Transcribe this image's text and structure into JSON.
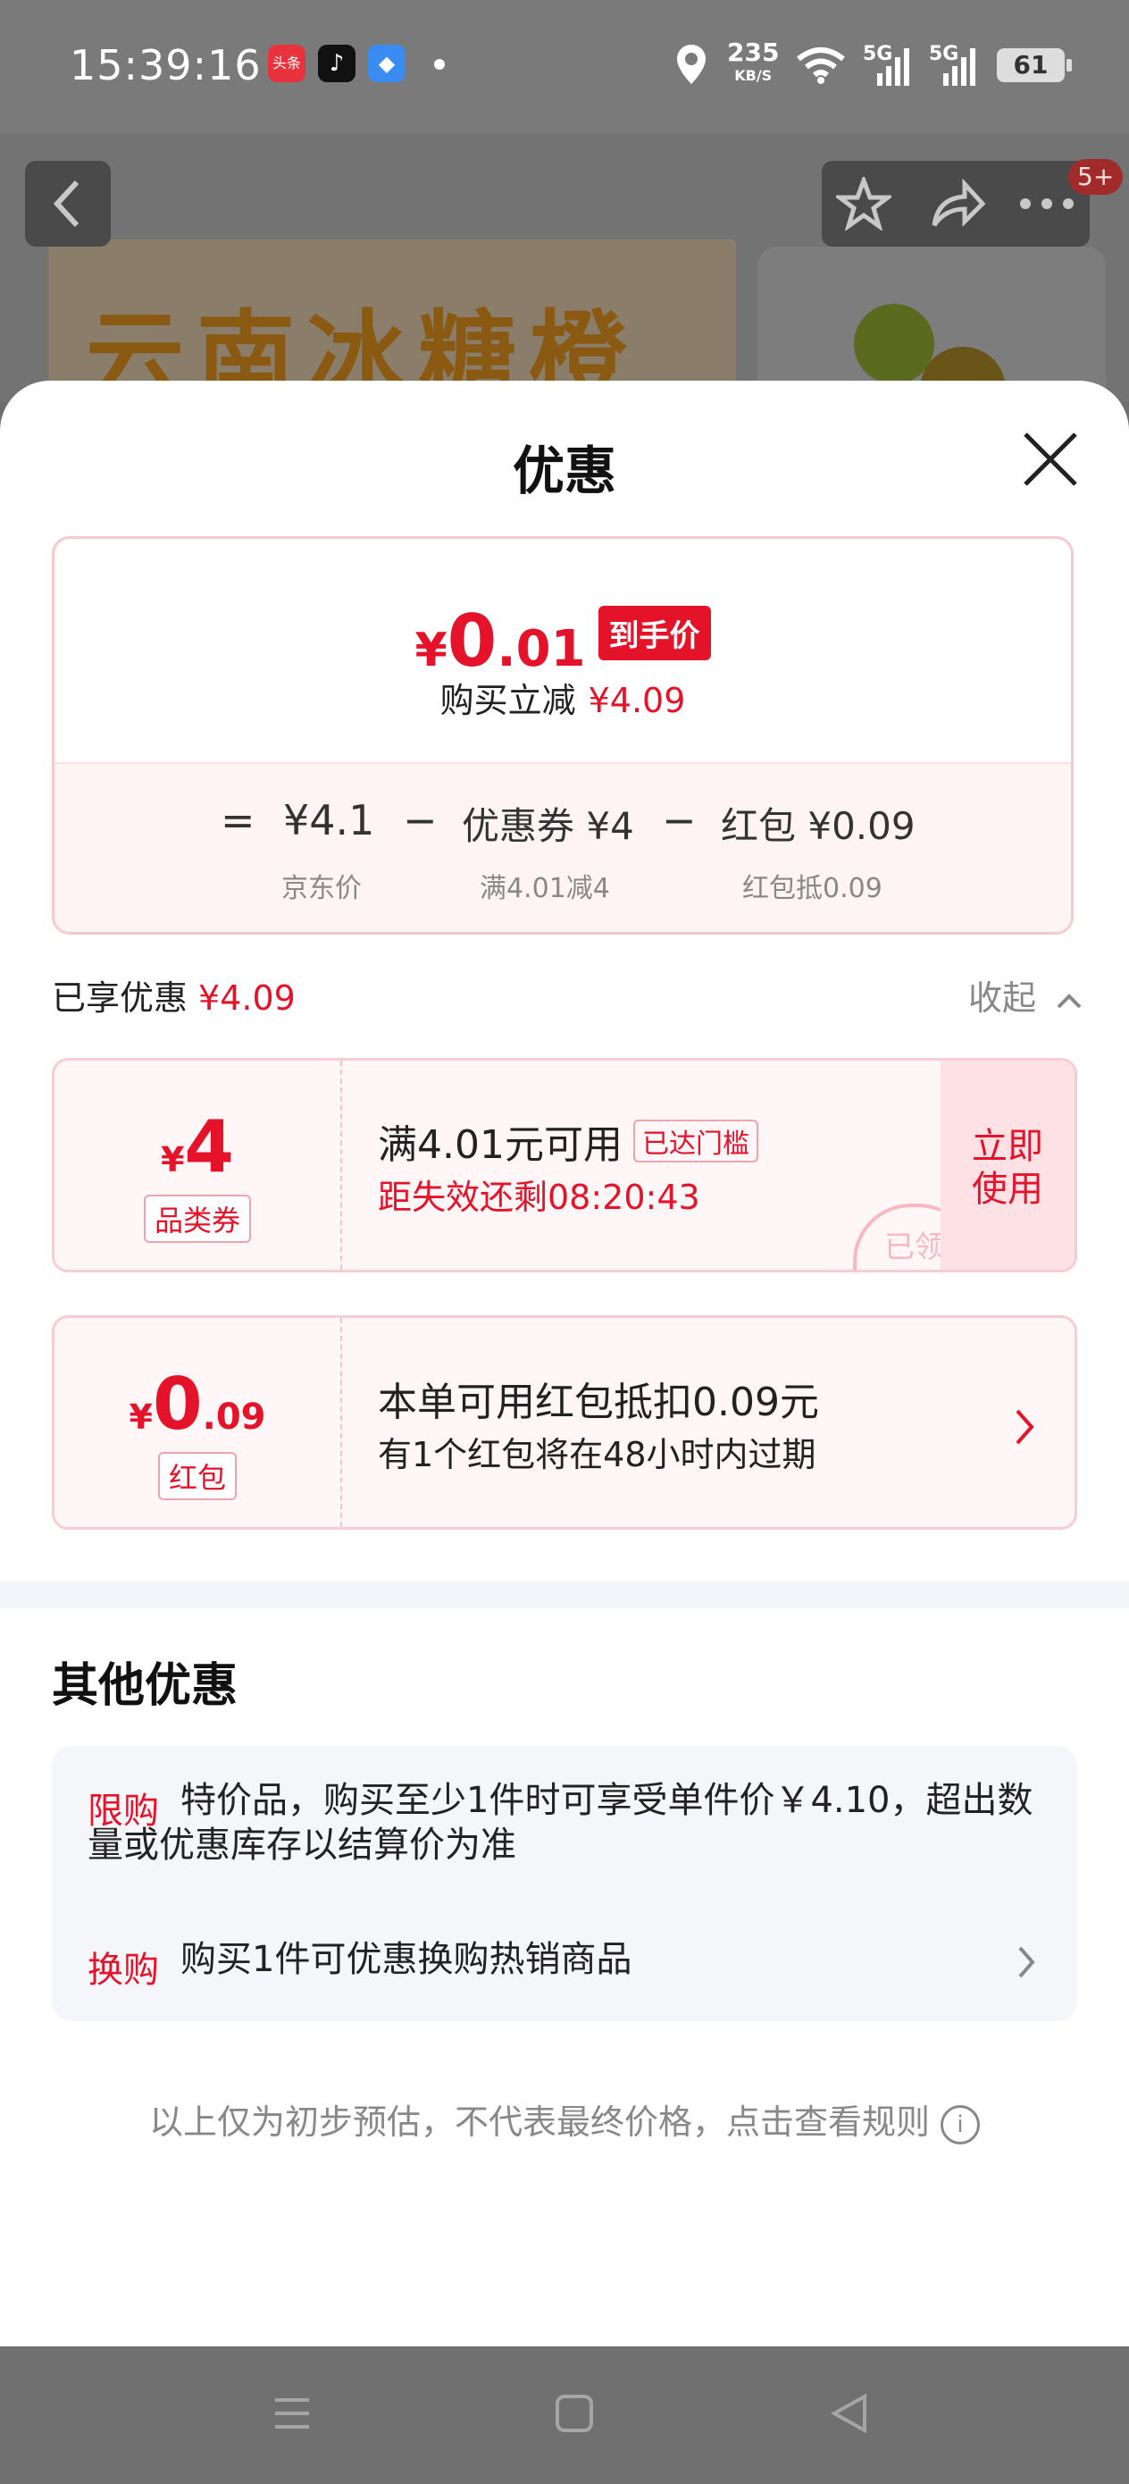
{
  "status_bar": {
    "time": "15:39:16",
    "app_icons": [
      {
        "name": "toutiao-app-icon",
        "label": "头条",
        "color": "#e8333c"
      },
      {
        "name": "tiktok-app-icon",
        "label": "♪",
        "color": "#111111"
      },
      {
        "name": "browser-app-icon",
        "label": "◆",
        "color": "#3a8cf0"
      }
    ],
    "net_speed": "235",
    "net_unit": "KB/S",
    "signal1": "5G",
    "signal2": "5G",
    "battery": "61"
  },
  "header": {
    "banner_text": "云南冰糖橙",
    "badge": "5+"
  },
  "sheet": {
    "title": "优惠",
    "summary": {
      "yen": "¥",
      "price_int": "0",
      "price_dec": ".01",
      "tag": "到手价",
      "reduce_label": "购买立减",
      "reduce_value": "¥4.09",
      "equation": {
        "eq": "=",
        "jd_price": "¥4.1",
        "minus1": "−",
        "coupon": "优惠券 ¥4",
        "minus2": "−",
        "redpacket": "红包 ¥0.09"
      },
      "sub_labels": {
        "jd_price_label": "京东价",
        "coupon_label": "满4.01减4",
        "redpacket_label": "红包抵0.09"
      }
    },
    "enjoyed": {
      "label": "已享优惠",
      "value": "¥4.09",
      "collapse": "收起"
    },
    "coupon_card": {
      "yen": "¥",
      "amount": "4",
      "type": "品类券",
      "condition": "满4.01元可用",
      "threshold": "已达门槛",
      "countdown": "距失效还剩08:20:43",
      "button": "立即\n使用",
      "stamp": "已领"
    },
    "redpacket_card": {
      "yen": "¥",
      "amount_int": "0",
      "amount_dec": ".09",
      "type": "红包",
      "main": "本单可用红包抵扣0.09元",
      "sub": "有1个红包将在48小时内过期"
    },
    "other": {
      "title": "其他优惠",
      "items": [
        {
          "label": "限购",
          "text": "特价品，购买至少1件时可享受单件价￥4.10，超出数量或优惠库存以结算价为准"
        },
        {
          "label": "换购",
          "text": "购买1件可优惠换购热销商品"
        }
      ]
    },
    "note": "以上仅为初步预估，不代表最终价格，点击查看规则"
  },
  "colors": {
    "accent": "#e4132a",
    "pink_border": "#f7ccd3"
  }
}
